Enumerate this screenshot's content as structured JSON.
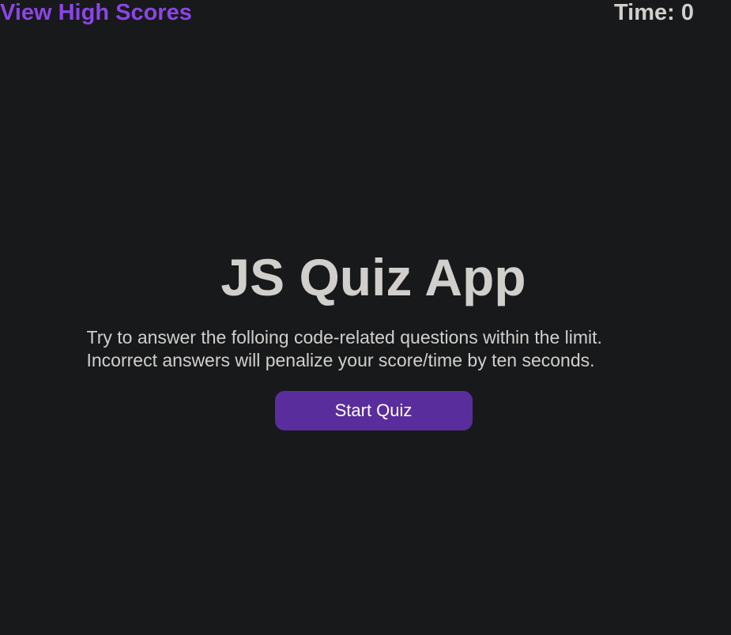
{
  "header": {
    "high_scores_link": "View High Scores",
    "timer_label": "Time:",
    "timer_value": "0"
  },
  "intro": {
    "title": "JS Quiz App",
    "description_lines": [
      "Try to answer the folloing code-related questions within the limit.",
      "Incorrect answers will penalize your score/time by ten seconds."
    ],
    "start_button_label": "Start Quiz"
  },
  "colors": {
    "background": "#18191b",
    "text": "#d1cfcc",
    "link": "#8b45e6",
    "button": "#5a2d9c",
    "button_text": "#ffffff"
  }
}
